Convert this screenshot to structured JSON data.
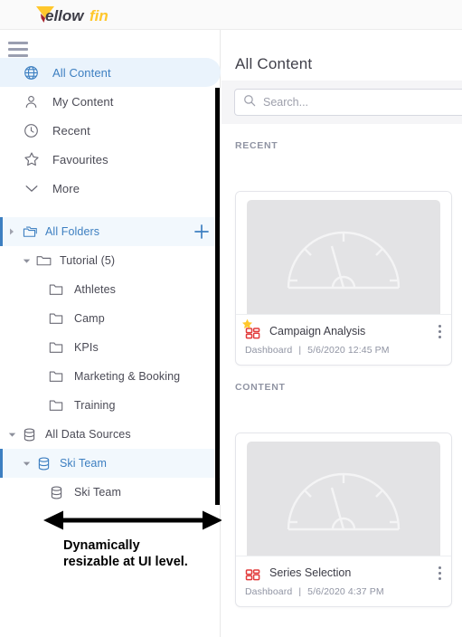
{
  "brand": {
    "name_dark": "ellow",
    "name_accent": "fin",
    "accent_color": "#FFC72C",
    "dark_color": "#3C3C46"
  },
  "sidebar": {
    "menu_icon": "hamburger-icon",
    "nav": [
      {
        "label": "All Content",
        "icon": "globe-icon",
        "selected": true
      },
      {
        "label": "My Content",
        "icon": "person-icon",
        "selected": false
      },
      {
        "label": "Recent",
        "icon": "clock-icon",
        "selected": false
      },
      {
        "label": "Favourites",
        "icon": "star-outline-icon",
        "selected": false
      },
      {
        "label": "More",
        "icon": "chevron-down-icon",
        "selected": false
      }
    ],
    "tree": [
      {
        "label": "All Folders",
        "icon": "folders-icon",
        "indent": 0,
        "caret": "right",
        "highlight": true,
        "blue": true,
        "action": "add-folder-button"
      },
      {
        "label": "Tutorial (5)",
        "icon": "folder-open-icon",
        "indent": 1,
        "caret": "down",
        "highlight": false,
        "blue": false
      },
      {
        "label": "Athletes",
        "icon": "folder-icon",
        "indent": 2,
        "caret": "none",
        "highlight": false,
        "blue": false
      },
      {
        "label": "Camp",
        "icon": "folder-icon",
        "indent": 2,
        "caret": "none",
        "highlight": false,
        "blue": false
      },
      {
        "label": "KPIs",
        "icon": "folder-icon",
        "indent": 2,
        "caret": "none",
        "highlight": false,
        "blue": false
      },
      {
        "label": "Marketing & Booking",
        "icon": "folder-icon",
        "indent": 2,
        "caret": "none",
        "highlight": false,
        "blue": false
      },
      {
        "label": "Training",
        "icon": "folder-icon",
        "indent": 2,
        "caret": "none",
        "highlight": false,
        "blue": false
      },
      {
        "label": "All Data Sources",
        "icon": "database-icon",
        "indent": 0,
        "caret": "down",
        "highlight": false,
        "blue": false
      },
      {
        "label": "Ski Team",
        "icon": "database-icon",
        "indent": 1,
        "caret": "down",
        "highlight": true,
        "blue": true
      },
      {
        "label": "Ski Team",
        "icon": "database-icon",
        "indent": 2,
        "caret": "none",
        "highlight": false,
        "blue": false
      }
    ],
    "add_folder_label": "+"
  },
  "annotation": {
    "line1": "Dynamically",
    "line2": "resizable at UI level.",
    "arrow": "double-headed-horizontal-arrow",
    "divider": "resize-handle"
  },
  "main": {
    "title": "All Content",
    "search": {
      "value": "",
      "placeholder": "Search...",
      "icon": "search-icon"
    },
    "sections": [
      {
        "heading": "RECENT"
      },
      {
        "heading": "CONTENT"
      }
    ],
    "cards": [
      {
        "title": "Campaign Analysis",
        "type": "Dashboard",
        "separator": "|",
        "timestamp": "5/6/2020 12:45 PM",
        "thumbnail": "gauge-chart-icon",
        "icon": "dashboard-grid-icon",
        "favourite": true,
        "favourite_icon": "star-filled-icon",
        "menu_icon": "kebab-menu-icon"
      },
      {
        "title": "Series Selection",
        "type": "Dashboard",
        "separator": "|",
        "timestamp": "5/6/2020 4:37 PM",
        "thumbnail": "gauge-chart-icon",
        "icon": "dashboard-grid-icon",
        "favourite": false,
        "favourite_icon": "star-filled-icon",
        "menu_icon": "kebab-menu-icon"
      }
    ]
  },
  "colors": {
    "accent_blue": "#3D7FC1",
    "selected_bg": "#EAF3FC",
    "brand_yellow": "#FFC72C",
    "dashboard_red": "#E23B3B"
  }
}
